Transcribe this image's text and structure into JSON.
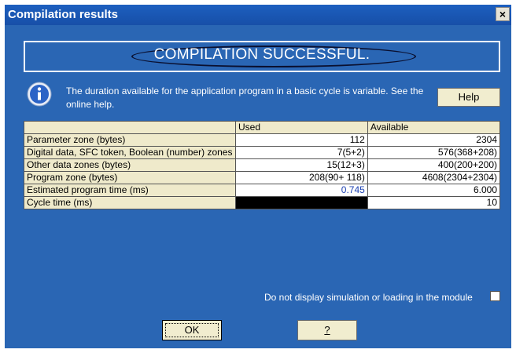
{
  "window": {
    "title": "Compilation results",
    "close_label": "×"
  },
  "status": {
    "message": "COMPILATION SUCCESSFUL."
  },
  "info": {
    "icon": "info-icon",
    "text": "The duration available for the application program in a basic cycle is variable. See the online help.",
    "help_label": "Help"
  },
  "table": {
    "headers": [
      "",
      "Used",
      "Available"
    ],
    "rows": [
      {
        "label": "Parameter zone (bytes)",
        "used": "112",
        "available": "2304"
      },
      {
        "label": "Digital data, SFC token, Boolean (number) zones",
        "used": "7(5+2)",
        "available": "576(368+208)"
      },
      {
        "label": "Other data zones (bytes)",
        "used": "15(12+3)",
        "available": "400(200+200)"
      },
      {
        "label": "Program zone (bytes)",
        "used": "208(90+ 118)",
        "available": "4608(2304+2304)"
      },
      {
        "label": "Estimated program time (ms)",
        "used": "0.745",
        "available": "6.000"
      },
      {
        "label": "Cycle time (ms)",
        "used": "",
        "available": "10"
      }
    ]
  },
  "options": {
    "no_display_label": "Do not display simulation or loading in the module",
    "no_display_checked": false
  },
  "buttons": {
    "ok_label": "OK",
    "question_label": "?"
  },
  "colors": {
    "title_bar": "#1d5fbf",
    "dialog_bg": "#2a66b4",
    "header_bg": "#efeacb",
    "used_value_accent": "#1a3fb0"
  }
}
